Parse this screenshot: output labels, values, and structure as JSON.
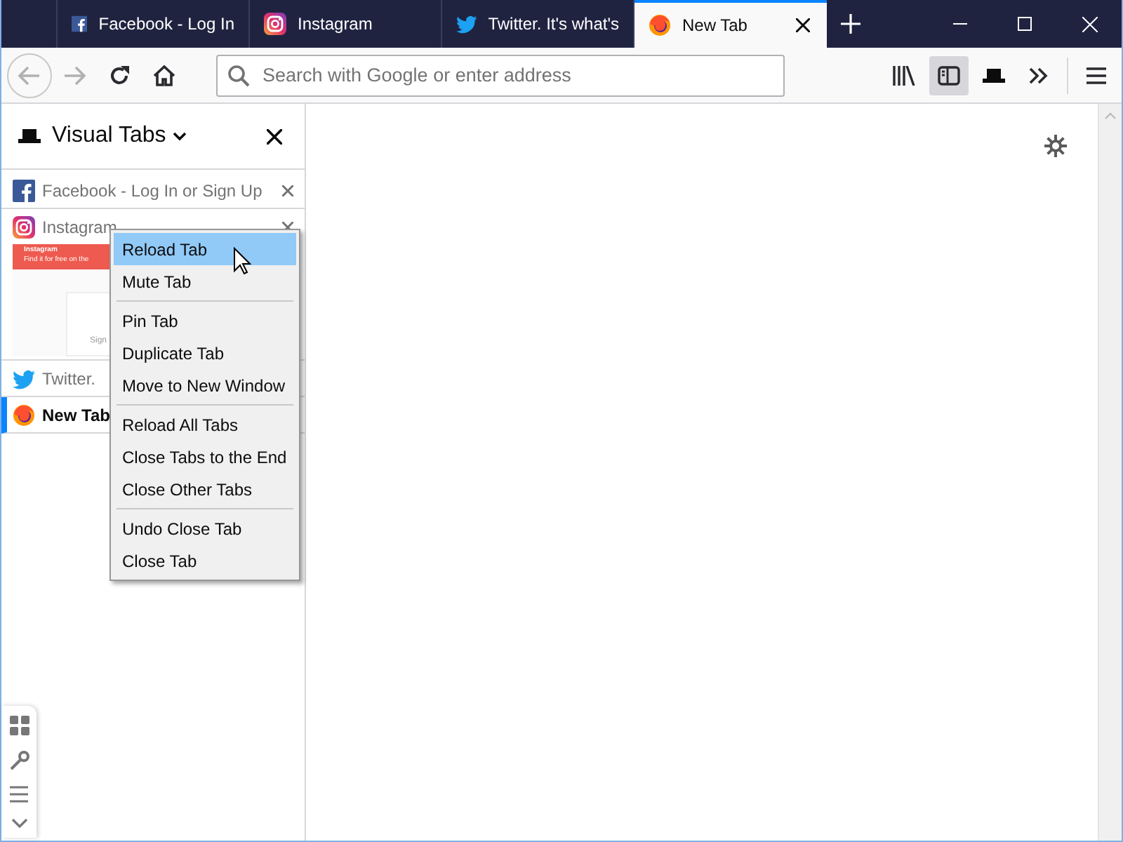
{
  "tabs": [
    {
      "title": "Facebook - Log In",
      "kind": "facebook",
      "selected": false
    },
    {
      "title": "Instagram",
      "kind": "instagram",
      "selected": false
    },
    {
      "title": "Twitter. It's what's",
      "kind": "twitter",
      "selected": false
    },
    {
      "title": "New Tab",
      "kind": "firefox",
      "selected": true
    }
  ],
  "address_bar": {
    "placeholder": "Search with Google or enter address"
  },
  "sidebar": {
    "title": "Visual Tabs",
    "tabs": [
      {
        "title": "Facebook - Log In or Sign Up",
        "kind": "facebook",
        "selected": false,
        "close_button": true
      },
      {
        "title": "Instagram",
        "kind": "instagram",
        "selected": false,
        "close_button": true,
        "thumbnail": {
          "heading": "Instagram",
          "subheading": "Find it for free on the",
          "button": "Sign"
        }
      },
      {
        "title": "Twitter.",
        "kind": "twitter",
        "selected": false
      },
      {
        "title": "New Tab",
        "kind": "firefox",
        "selected": true
      }
    ]
  },
  "context_menu": [
    {
      "kind": "item",
      "label": "Reload Tab",
      "selected": true
    },
    {
      "kind": "item",
      "label": "Mute Tab",
      "selected": false
    },
    {
      "kind": "separator"
    },
    {
      "kind": "item",
      "label": "Pin Tab",
      "selected": false
    },
    {
      "kind": "item",
      "label": "Duplicate Tab",
      "selected": false
    },
    {
      "kind": "item",
      "label": "Move to New Window",
      "selected": false
    },
    {
      "kind": "separator"
    },
    {
      "kind": "item",
      "label": "Reload All Tabs",
      "selected": false
    },
    {
      "kind": "item",
      "label": "Close Tabs to the End",
      "selected": false
    },
    {
      "kind": "item",
      "label": "Close Other Tabs",
      "selected": false
    },
    {
      "kind": "separator"
    },
    {
      "kind": "item",
      "label": "Undo Close Tab",
      "selected": false
    },
    {
      "kind": "item",
      "label": "Close Tab",
      "selected": false
    }
  ]
}
